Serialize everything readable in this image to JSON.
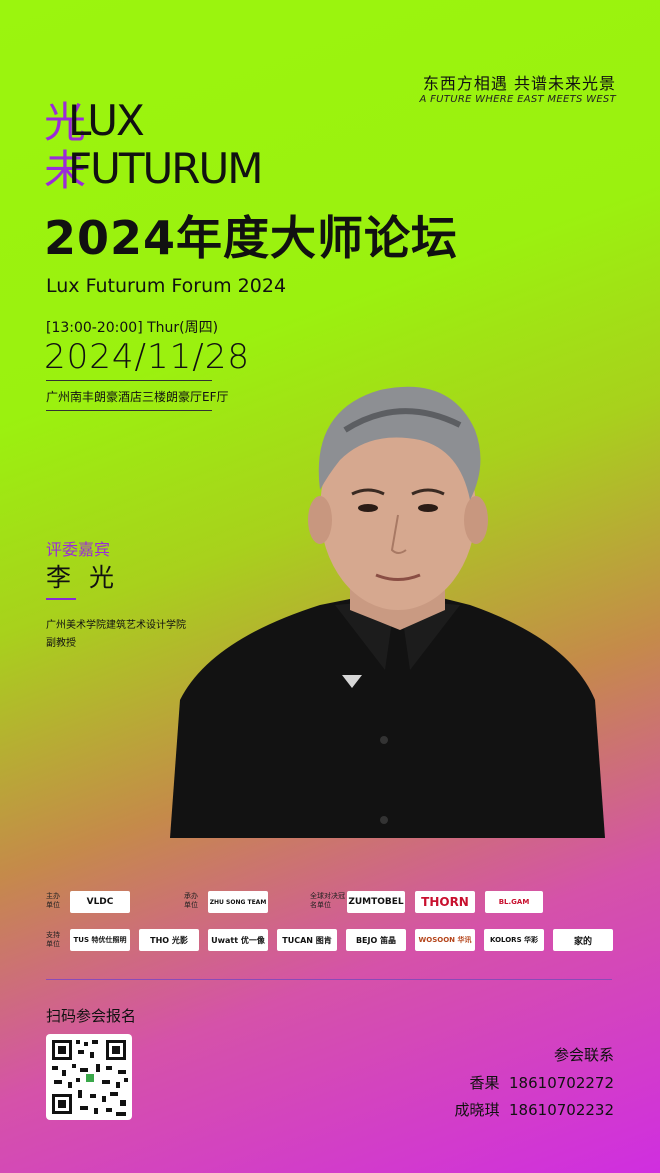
{
  "tagline": {
    "cn": "东西方相遇  共谱未来光景",
    "en": "A FUTURE WHERE EAST MEETS WEST"
  },
  "logo": {
    "line1": "LUX",
    "line2": "FUTURUM",
    "mark1": "光",
    "mark2": "未"
  },
  "event": {
    "title": "2024年度大师论坛",
    "subtitle": "Lux Futurum Forum 2024",
    "time": "[13:00-20:00] Thur(周四)",
    "date": "2024/11/28",
    "venue": "广州南丰朗豪酒店三楼朗豪厅EF厅"
  },
  "speaker": {
    "role": "评委嘉宾",
    "name": "李光",
    "affiliation": "广州美术学院建筑艺术设计学院",
    "title": "副教授"
  },
  "sponsors": {
    "host_label": "主办单位",
    "organizer_label": "承办单位",
    "global_label": "全球对决冠名单位",
    "support_label": "支持单位",
    "host": [
      "VLDC"
    ],
    "organizer": [
      "ZHU SONG TEAM"
    ],
    "global": [
      "ZUMTOBEL",
      "THORN",
      "BL.GAM"
    ],
    "support": [
      "TUS 特优仕照明",
      "THO 光影",
      "Uwatt 优一像",
      "TUCAN 图肯",
      "BEJO 笛晶",
      "WOSOON 华讯",
      "KOLORS 华彩",
      "家的"
    ]
  },
  "registration": {
    "label": "扫码参会报名"
  },
  "contact": {
    "title": "参会联系",
    "people": [
      {
        "name": "香果",
        "phone": "18610702272"
      },
      {
        "name": "成晓琪",
        "phone": "18610702232"
      }
    ]
  },
  "colors": {
    "accent_purple": "#9a2bd8",
    "lime": "#9bf50e",
    "magenta": "#d02ee0"
  }
}
